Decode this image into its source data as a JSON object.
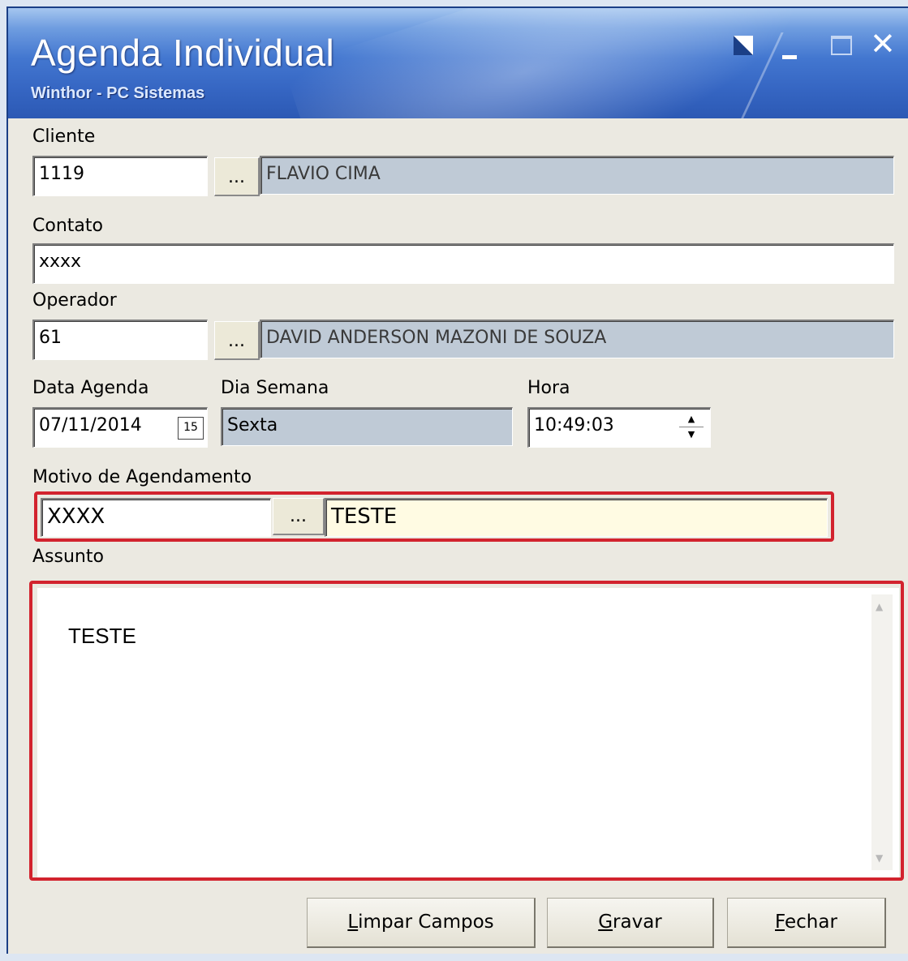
{
  "window": {
    "title": "Agenda Individual",
    "subtitle": "Winthor - PC Sistemas"
  },
  "cliente": {
    "label": "Cliente",
    "code": "1119",
    "lookup": "...",
    "name": "FLAVIO CIMA"
  },
  "contato": {
    "label": "Contato",
    "value": "xxxx"
  },
  "operador": {
    "label": "Operador",
    "code": "61",
    "lookup": "...",
    "name": "DAVID ANDERSON MAZONI DE SOUZA"
  },
  "data_agenda": {
    "label": "Data Agenda",
    "value": "07/11/2014",
    "calendar_glyph": "15"
  },
  "dia_semana": {
    "label": "Dia Semana",
    "value": "Sexta"
  },
  "hora": {
    "label": "Hora",
    "value": "10:49:03"
  },
  "motivo": {
    "label": "Motivo de Agendamento",
    "code": "XXXX",
    "lookup": "...",
    "description": "TESTE"
  },
  "assunto": {
    "label": "Assunto",
    "text": "TESTE"
  },
  "buttons": {
    "limpar": {
      "accel": "L",
      "rest": "impar Campos"
    },
    "gravar": {
      "accel": "G",
      "rest": "ravar"
    },
    "fechar": {
      "accel": "F",
      "rest": "echar"
    }
  },
  "colors": {
    "highlight": "#d2232e",
    "readonly_field": "#bfcad6",
    "titlebar": "#3565c2"
  },
  "icons": [
    "restore-edit-icon",
    "minimize-icon",
    "maximize-icon",
    "close-icon",
    "calendar-icon",
    "spin-up-icon",
    "spin-down-icon",
    "scroll-up-icon",
    "scroll-down-icon"
  ]
}
